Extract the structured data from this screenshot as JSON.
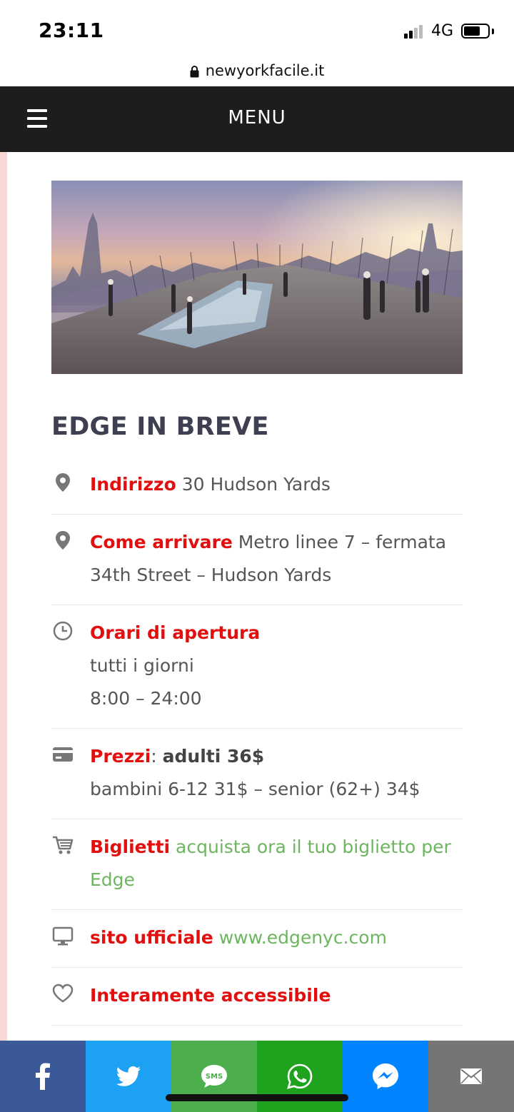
{
  "status_bar": {
    "time": "23:11",
    "network": "4G",
    "battery_icon": "battery-icon",
    "signal_icon": "signal-icon"
  },
  "browser": {
    "url": "newyorkfacile.it",
    "lock_icon": "lock-icon"
  },
  "nav": {
    "menu_label": "MENU",
    "menu_icon": "hamburger-icon",
    "background": "#1d1d20"
  },
  "hero": {
    "image": "Edge observation deck rooftop view of Manhattan skyline at sunset"
  },
  "section": {
    "title": "EDGE IN BREVE"
  },
  "info": {
    "address": {
      "icon": "location-pin-icon",
      "label": "Indirizzo",
      "value": " 30 Hudson Yards"
    },
    "directions": {
      "icon": "location-pin-icon",
      "label": "Come arrivare",
      "value": " Metro linee 7 – fermata 34th Street – Hudson Yards"
    },
    "hours": {
      "icon": "clock-icon",
      "label": "Orari di apertura",
      "line1": "tutti i giorni",
      "line2": "8:00 – 24:00"
    },
    "prices": {
      "icon": "credit-card-icon",
      "label": "Prezzi",
      "separator": ": ",
      "adults": "adulti 36$",
      "others": "bambini 6-12 31$ – senior (62+) 34$"
    },
    "tickets": {
      "icon": "shopping-cart-icon",
      "label": "Biglietti",
      "link_text": "acquista ora il tuo biglietto per Edge"
    },
    "website": {
      "icon": "monitor-icon",
      "label": "sito ufficiale",
      "link_text": "www.edgenyc.com"
    },
    "accessibility": {
      "icon": "heart-icon",
      "label": "Interamente accessibile"
    }
  },
  "colors": {
    "label_red": "#e20f0f",
    "link_green": "#6db55f",
    "title": "#3f3f52",
    "side_strip": "#f7d8d2"
  },
  "share_bar": [
    {
      "icon": "facebook-icon",
      "color": "#3b5998"
    },
    {
      "icon": "twitter-icon",
      "color": "#1da1f2"
    },
    {
      "icon": "sms-icon",
      "color": "#4cae4c",
      "text": "SMS"
    },
    {
      "icon": "whatsapp-icon",
      "color": "#1fa31f"
    },
    {
      "icon": "messenger-icon",
      "color": "#0084ff"
    },
    {
      "icon": "email-icon",
      "color": "#757575"
    }
  ]
}
